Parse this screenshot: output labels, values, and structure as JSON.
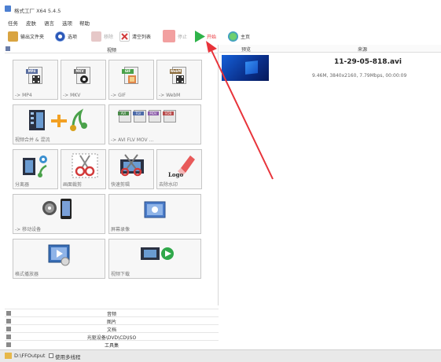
{
  "window": {
    "title": "格式工厂 X64 5.4.5"
  },
  "menu": [
    "任务",
    "皮肤",
    "语言",
    "选项",
    "帮助"
  ],
  "toolbar": {
    "output_folder": "输出文件夹",
    "options": "选项",
    "remove": "移除",
    "clear_list": "清空列表",
    "stop": "停止",
    "start": "开始",
    "home": "主页"
  },
  "left_panel": {
    "header": "视频",
    "tiles": [
      {
        "label": "-> MP4",
        "band": "MP4",
        "color": "#5b6fa0"
      },
      {
        "label": "-> MKV",
        "band": "MKV",
        "color": "#6a6a6a"
      },
      {
        "label": "-> GIF",
        "band": "GIF",
        "color": "#4aa14a"
      },
      {
        "label": "-> WebM",
        "band": "WebM",
        "color": "#8a6a3a"
      },
      {
        "label": "视频合并 & 混流"
      },
      {
        "label": "-> AVI FLV MOV ...",
        "badges": [
          "AVI",
          "FLV",
          "MOV",
          "VOB"
        ]
      },
      {
        "label": "分离器"
      },
      {
        "label": "画面裁剪"
      },
      {
        "label": "快速剪辑"
      },
      {
        "label": "去除水印",
        "logo": "Logo"
      },
      {
        "label": "-> 移动设备"
      },
      {
        "label": "屏幕录像"
      },
      {
        "label": "格式播放器"
      },
      {
        "label": "视频下载"
      }
    ]
  },
  "categories": [
    "音频",
    "图片",
    "文档",
    "光驱设备\\DVD\\CD\\ISO",
    "工具集"
  ],
  "right_panel": {
    "col_preview": "预览",
    "col_source": "来源",
    "file": {
      "name": "11-29-05-818.avi",
      "info": "9.46M, 3840x2160, 7.79Mbps, 00:00:09"
    }
  },
  "status": {
    "path": "D:\\FFOutput",
    "multithread": "使用多线程"
  },
  "colors": {
    "accent": "#e8333a",
    "start": "#2fb34a"
  }
}
